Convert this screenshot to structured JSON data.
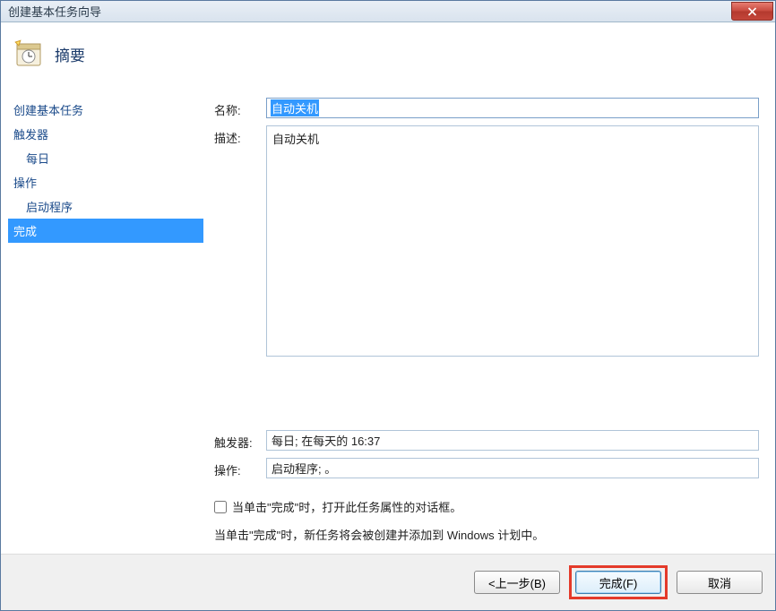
{
  "titlebar": {
    "title": "创建基本任务向导"
  },
  "header": {
    "title": "摘要"
  },
  "sidebar": {
    "items": [
      {
        "label": "创建基本任务",
        "sub": false,
        "active": false
      },
      {
        "label": "触发器",
        "sub": false,
        "active": false
      },
      {
        "label": "每日",
        "sub": true,
        "active": false
      },
      {
        "label": "操作",
        "sub": false,
        "active": false
      },
      {
        "label": "启动程序",
        "sub": true,
        "active": false
      },
      {
        "label": "完成",
        "sub": false,
        "active": true
      }
    ]
  },
  "form": {
    "name_label": "名称:",
    "name_value": "自动关机",
    "desc_label": "描述:",
    "desc_value": "自动关机",
    "trigger_label": "触发器:",
    "trigger_value": "每日; 在每天的 16:37",
    "action_label": "操作:",
    "action_value": "启动程序; 。",
    "checkbox_label": "当单击\"完成\"时，打开此任务属性的对话框。",
    "info_text": "当单击\"完成\"时，新任务将会被创建并添加到 Windows 计划中。"
  },
  "footer": {
    "back_label": "<上一步(B)",
    "finish_label": "完成(F)",
    "cancel_label": "取消"
  }
}
